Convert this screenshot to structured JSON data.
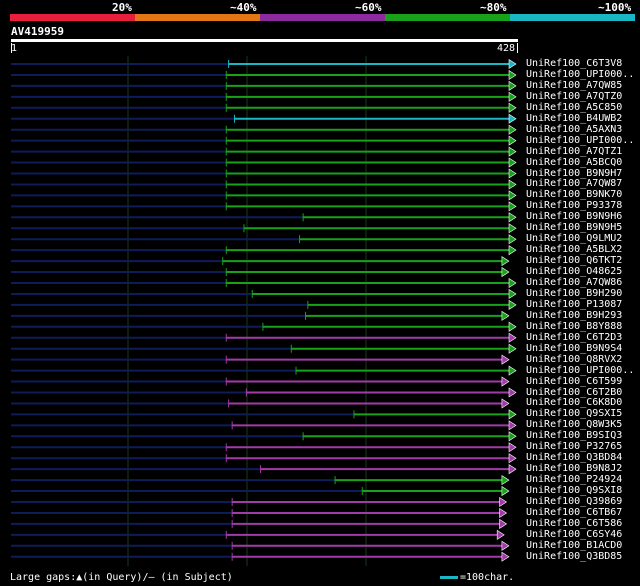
{
  "header": {
    "percent_labels": [
      "20%",
      "~40%",
      "~60%",
      "~80%",
      "~100%"
    ],
    "percent_colors": [
      "#e81f3a",
      "#e37716",
      "#8e2aa0",
      "#17a21a",
      "#19b7c4"
    ]
  },
  "query": {
    "name": "AV419959",
    "start": "1",
    "end": "428"
  },
  "colors": {
    "cyan": "#19b7c4",
    "green": "#17a21a",
    "magenta": "#a23aa9",
    "navy": "#0e1c5a",
    "grid": "#1a3a1a"
  },
  "chart_data": {
    "type": "alignment",
    "query_length": 428,
    "hits": [
      {
        "id": "UniRef100_C6T3V8",
        "start": 185,
        "end": 428,
        "color": "cyan"
      },
      {
        "id": "UniRef100_UPI000..",
        "start": 183,
        "end": 428,
        "color": "green"
      },
      {
        "id": "UniRef100_A7QW85",
        "start": 183,
        "end": 428,
        "color": "green"
      },
      {
        "id": "UniRef100_A7QTZ0",
        "start": 183,
        "end": 428,
        "color": "green"
      },
      {
        "id": "UniRef100_A5C850",
        "start": 183,
        "end": 428,
        "color": "green"
      },
      {
        "id": "UniRef100_B4UWB2",
        "start": 190,
        "end": 428,
        "color": "cyan"
      },
      {
        "id": "UniRef100_A5AXN3",
        "start": 183,
        "end": 428,
        "color": "green"
      },
      {
        "id": "UniRef100_UPI000..",
        "start": 183,
        "end": 428,
        "color": "green"
      },
      {
        "id": "UniRef100_A7QTZ1",
        "start": 183,
        "end": 428,
        "color": "green"
      },
      {
        "id": "UniRef100_A5BCQ0",
        "start": 183,
        "end": 428,
        "color": "green"
      },
      {
        "id": "UniRef100_B9N9H7",
        "start": 183,
        "end": 428,
        "color": "green"
      },
      {
        "id": "UniRef100_A7QW87",
        "start": 183,
        "end": 428,
        "color": "green"
      },
      {
        "id": "UniRef100_B9NK70",
        "start": 183,
        "end": 428,
        "color": "green"
      },
      {
        "id": "UniRef100_P93378",
        "start": 183,
        "end": 428,
        "color": "green"
      },
      {
        "id": "UniRef100_B9N9H6",
        "start": 248,
        "end": 428,
        "color": "green"
      },
      {
        "id": "UniRef100_B9N9H5",
        "start": 198,
        "end": 428,
        "color": "green"
      },
      {
        "id": "UniRef100_Q9LMU2",
        "start": 245,
        "end": 428,
        "color": "green"
      },
      {
        "id": "UniRef100_A5BLX2",
        "start": 183,
        "end": 428,
        "color": "green"
      },
      {
        "id": "UniRef100_Q6TKT2",
        "start": 180,
        "end": 422,
        "color": "green"
      },
      {
        "id": "UniRef100_O48625",
        "start": 183,
        "end": 422,
        "color": "green"
      },
      {
        "id": "UniRef100_A7QW86",
        "start": 183,
        "end": 428,
        "color": "green"
      },
      {
        "id": "UniRef100_B9H290",
        "start": 205,
        "end": 428,
        "color": "green"
      },
      {
        "id": "UniRef100_P13087",
        "start": 252,
        "end": 428,
        "color": "green"
      },
      {
        "id": "UniRef100_B9H293",
        "start": 250,
        "end": 422,
        "color": "green"
      },
      {
        "id": "UniRef100_B8Y888",
        "start": 214,
        "end": 428,
        "color": "green"
      },
      {
        "id": "UniRef100_C6T2D3",
        "start": 183,
        "end": 428,
        "color": "magenta"
      },
      {
        "id": "UniRef100_B9N9S4",
        "start": 238,
        "end": 428,
        "color": "green"
      },
      {
        "id": "UniRef100_Q8RVX2",
        "start": 183,
        "end": 422,
        "color": "magenta"
      },
      {
        "id": "UniRef100_UPI000..",
        "start": 242,
        "end": 428,
        "color": "green"
      },
      {
        "id": "UniRef100_C6T599",
        "start": 183,
        "end": 422,
        "color": "magenta"
      },
      {
        "id": "UniRef100_C6T2B0",
        "start": 200,
        "end": 428,
        "color": "magenta"
      },
      {
        "id": "UniRef100_C6K8D0",
        "start": 185,
        "end": 422,
        "color": "magenta"
      },
      {
        "id": "UniRef100_Q9SXI5",
        "start": 291,
        "end": 428,
        "color": "green"
      },
      {
        "id": "UniRef100_Q8W3K5",
        "start": 188,
        "end": 428,
        "color": "magenta"
      },
      {
        "id": "UniRef100_B9SIQ3",
        "start": 248,
        "end": 428,
        "color": "green"
      },
      {
        "id": "UniRef100_P32765",
        "start": 183,
        "end": 428,
        "color": "magenta"
      },
      {
        "id": "UniRef100_Q3BD84",
        "start": 183,
        "end": 428,
        "color": "magenta"
      },
      {
        "id": "UniRef100_B9N8J2",
        "start": 212,
        "end": 428,
        "color": "magenta"
      },
      {
        "id": "UniRef100_P24924",
        "start": 275,
        "end": 422,
        "color": "green"
      },
      {
        "id": "UniRef100_Q9SXI8",
        "start": 298,
        "end": 422,
        "color": "green"
      },
      {
        "id": "UniRef100_Q39869",
        "start": 188,
        "end": 420,
        "color": "magenta"
      },
      {
        "id": "UniRef100_C6TB67",
        "start": 188,
        "end": 420,
        "color": "magenta"
      },
      {
        "id": "UniRef100_C6T586",
        "start": 188,
        "end": 420,
        "color": "magenta"
      },
      {
        "id": "UniRef100_C6SY46",
        "start": 183,
        "end": 418,
        "color": "magenta"
      },
      {
        "id": "UniRef100_B1ACD0",
        "start": 188,
        "end": 422,
        "color": "magenta"
      },
      {
        "id": "UniRef100_Q3BD85",
        "start": 188,
        "end": 422,
        "color": "magenta"
      }
    ]
  },
  "footer": {
    "legend_text": "Large gaps:▲(in Query)/— (in Subject)",
    "scale_text": "=100char."
  }
}
